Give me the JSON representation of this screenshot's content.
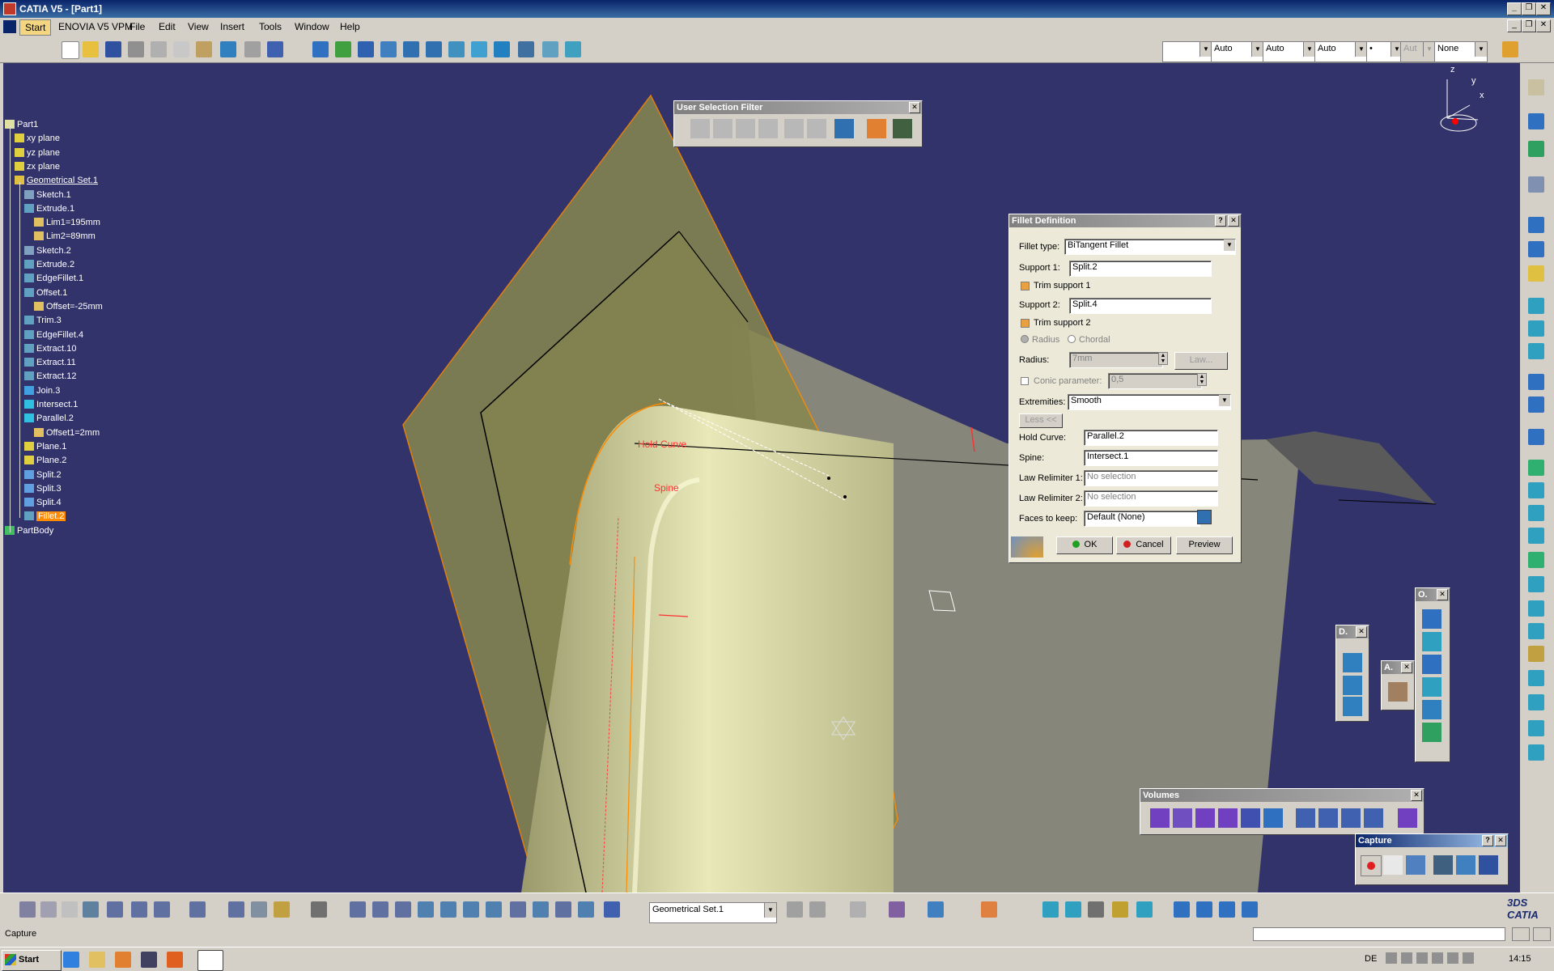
{
  "window": {
    "title": "CATIA V5 - [Part1]"
  },
  "menubar": [
    "Start",
    "ENOVIA V5 VPM",
    "File",
    "Edit",
    "View",
    "Insert",
    "Tools",
    "Window",
    "Help"
  ],
  "toolbar_right": {
    "combo1": "",
    "combo2": "Auto",
    "combo3": "Auto",
    "combo4": "Auto",
    "combo5": "•",
    "combo6": "Aut",
    "combo7": "None"
  },
  "compass": {
    "x": "x",
    "y": "y",
    "z": "z"
  },
  "tree": {
    "items": [
      {
        "label": "Part1",
        "indent": 0,
        "icon": "part-icon"
      },
      {
        "label": "xy plane",
        "indent": 1,
        "icon": "plane-icon"
      },
      {
        "label": "yz plane",
        "indent": 1,
        "icon": "plane-icon"
      },
      {
        "label": "zx plane",
        "indent": 1,
        "icon": "plane-icon"
      },
      {
        "label": "Geometrical Set.1",
        "indent": 1,
        "icon": "geoset-icon",
        "underline": true
      },
      {
        "label": "Sketch.1",
        "indent": 2,
        "icon": "sketch-icon"
      },
      {
        "label": "Extrude.1",
        "indent": 2,
        "icon": "extrude-icon"
      },
      {
        "label": "Lim1=195mm",
        "indent": 3,
        "icon": "param-icon"
      },
      {
        "label": "Lim2=89mm",
        "indent": 3,
        "icon": "param-icon"
      },
      {
        "label": "Sketch.2",
        "indent": 2,
        "icon": "sketch-icon"
      },
      {
        "label": "Extrude.2",
        "indent": 2,
        "icon": "extrude-icon"
      },
      {
        "label": "EdgeFillet.1",
        "indent": 2,
        "icon": "fillet-icon"
      },
      {
        "label": "Offset.1",
        "indent": 2,
        "icon": "offset-icon"
      },
      {
        "label": "Offset=-25mm",
        "indent": 3,
        "icon": "param-icon"
      },
      {
        "label": "Trim.3",
        "indent": 2,
        "icon": "trim-icon"
      },
      {
        "label": "EdgeFillet.4",
        "indent": 2,
        "icon": "fillet-icon"
      },
      {
        "label": "Extract.10",
        "indent": 2,
        "icon": "extract-icon"
      },
      {
        "label": "Extract.11",
        "indent": 2,
        "icon": "extract-icon"
      },
      {
        "label": "Extract.12",
        "indent": 2,
        "icon": "extract-icon"
      },
      {
        "label": "Join.3",
        "indent": 2,
        "icon": "join-icon"
      },
      {
        "label": "Intersect.1",
        "indent": 2,
        "icon": "intersect-icon"
      },
      {
        "label": "Parallel.2",
        "indent": 2,
        "icon": "parallel-icon"
      },
      {
        "label": "Offset1=2mm",
        "indent": 3,
        "icon": "param-icon"
      },
      {
        "label": "Plane.1",
        "indent": 2,
        "icon": "plane-icon"
      },
      {
        "label": "Plane.2",
        "indent": 2,
        "icon": "plane-icon"
      },
      {
        "label": "Split.2",
        "indent": 2,
        "icon": "split-icon"
      },
      {
        "label": "Split.3",
        "indent": 2,
        "icon": "split-icon"
      },
      {
        "label": "Split.4",
        "indent": 2,
        "icon": "split-icon"
      },
      {
        "label": "Fillet.2",
        "indent": 2,
        "icon": "fillet-icon",
        "selected": true
      },
      {
        "label": "PartBody",
        "indent": 0,
        "icon": "body-icon"
      }
    ]
  },
  "viewport": {
    "labels": {
      "hold_curve": "Hold Curve",
      "spine": "Spine"
    }
  },
  "user_selection_filter": {
    "title": "User Selection Filter"
  },
  "fillet_dialog": {
    "title": "Fillet Definition",
    "help": "?",
    "fillet_type_label": "Fillet type:",
    "fillet_type_value": "BiTangent Fillet",
    "support1_label": "Support 1:",
    "support1_value": "Split.2",
    "trim1_label": "Trim support 1",
    "support2_label": "Support 2:",
    "support2_value": "Split.4",
    "trim2_label": "Trim support 2",
    "radius_opt": "Radius",
    "chordal_opt": "Chordal",
    "radius_label": "Radius:",
    "radius_value": "7mm",
    "law_button": "Law...",
    "conic_label": "Conic parameter:",
    "conic_value": "0,5",
    "extremities_label": "Extremities:",
    "extremities_value": "Smooth",
    "less_button": "Less <<",
    "hold_curve_label": "Hold Curve:",
    "hold_curve_value": "Parallel.2",
    "spine_label": "Spine:",
    "spine_value": "Intersect.1",
    "law_rel1_label": "Law Relimiter 1:",
    "law_rel1_value": "No selection",
    "law_rel2_label": "Law Relimiter 2:",
    "law_rel2_value": "No selection",
    "faces_label": "Faces to keep:",
    "faces_value": "Default (None)",
    "ok_button": "OK",
    "cancel_button": "Cancel",
    "preview_button": "Preview"
  },
  "small_panels": {
    "d_title": "D.",
    "a_title": "A.",
    "o_title": "O."
  },
  "volumes_toolbar": {
    "title": "Volumes"
  },
  "capture_toolbar": {
    "title": "Capture",
    "help": "?"
  },
  "bottom_toolbar": {
    "geoset_combo": "Geometrical Set.1"
  },
  "status": {
    "text": "Capture"
  },
  "taskbar": {
    "start": "Start",
    "lang": "DE",
    "time": "14:15"
  },
  "colors": {
    "viewport_bg": "#33336b",
    "surface": "#a8a878",
    "selection": "#ff8c00",
    "dialog_bg": "#ece9d8"
  }
}
